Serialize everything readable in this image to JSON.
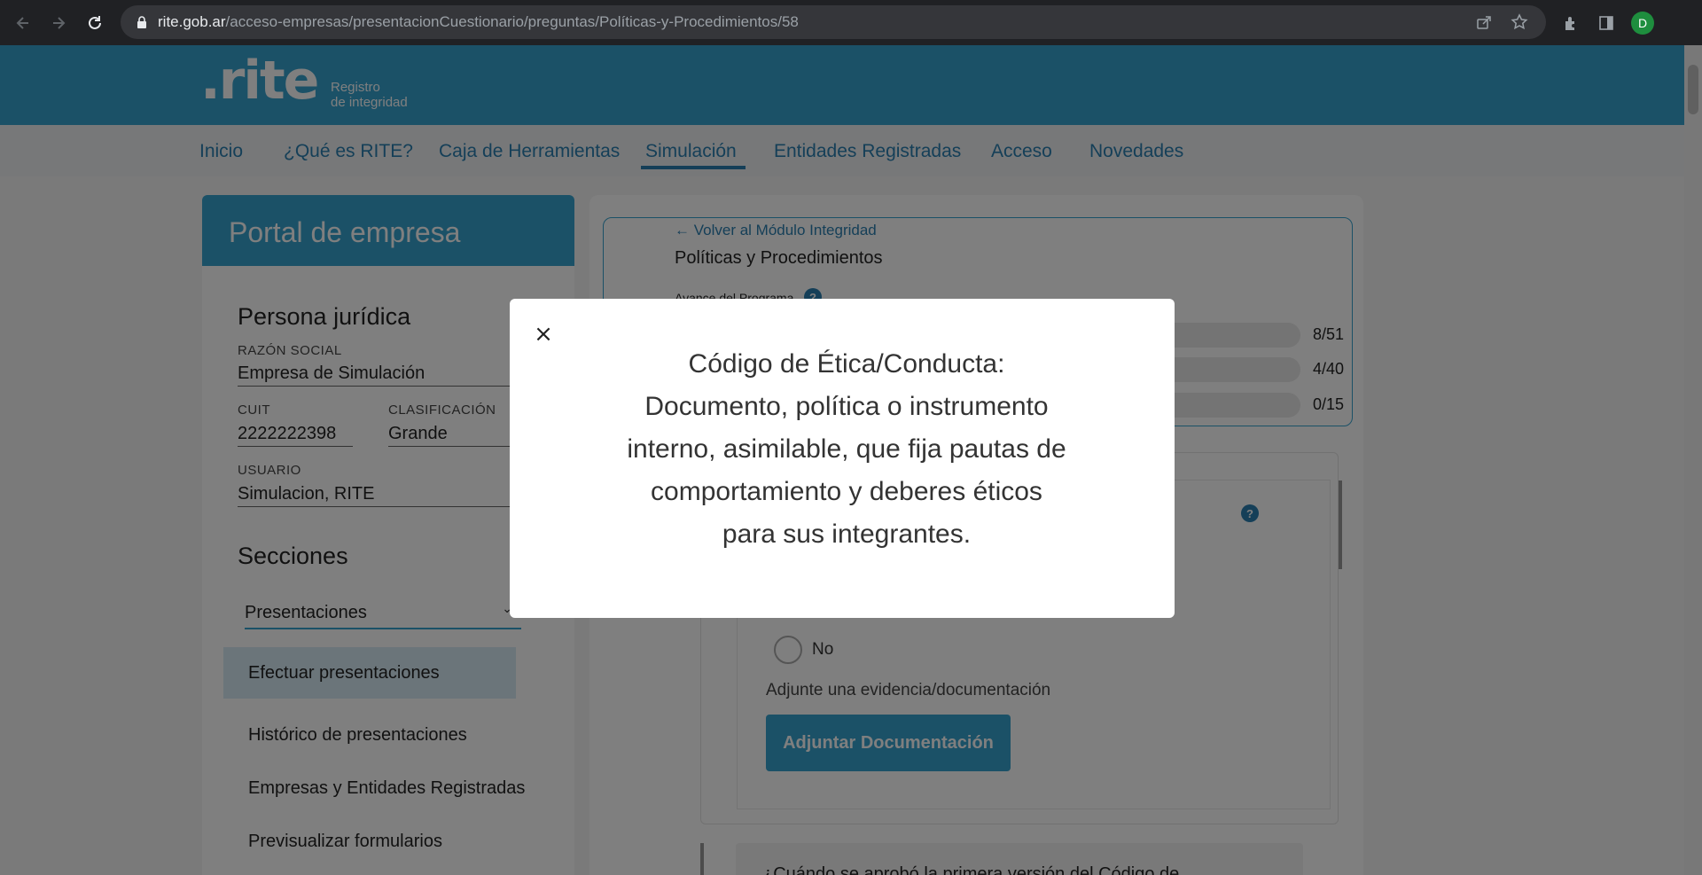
{
  "browser": {
    "url_host": "rite.gob.ar",
    "url_path": "/acceso-empresas/presentacionCuestionario/preguntas/Políticas-y-Procedimientos/58",
    "profile_initial": "D",
    "icons": [
      "back-icon",
      "forward-icon",
      "reload-icon",
      "lock-icon",
      "share-icon",
      "star-icon",
      "extensions-icon",
      "side-panel-icon"
    ]
  },
  "header": {
    "logo": ".rite",
    "logo_sub_1": "Registro",
    "logo_sub_2": "de integridad",
    "brand_color": "#37a3cf"
  },
  "nav": {
    "items": [
      {
        "label": "Inicio"
      },
      {
        "label": "¿Qué es RITE?"
      },
      {
        "label": "Caja de Herramientas"
      },
      {
        "label": "Simulación"
      },
      {
        "label": "Entidades Registradas"
      },
      {
        "label": "Acceso"
      },
      {
        "label": "Novedades"
      }
    ],
    "active": "Simulación"
  },
  "sidebar": {
    "title": "Portal de empresa",
    "persona_heading": "Persona jurídica",
    "razon_label": "RAZÓN SOCIAL",
    "razon_value": "Empresa de Simulación",
    "cuit_label": "CUIT",
    "cuit_value": "2222222398",
    "clasif_label": "CLASIFICACIÓN",
    "clasif_value": "Grande",
    "usuario_label": "USUARIO",
    "usuario_value": "Simulacion, RITE",
    "secciones_heading": "Secciones",
    "select_value": "Presentaciones",
    "items": [
      {
        "label": "Efectuar presentaciones"
      },
      {
        "label": "Histórico de presentaciones"
      },
      {
        "label": "Empresas y Entidades Registradas"
      },
      {
        "label": "Previsualizar formularios"
      }
    ]
  },
  "module": {
    "back_link": "Volver al Módulo Integridad",
    "title": "Políticas y Procedimientos",
    "avance_label": "Avance del Programa",
    "progress": [
      {
        "label": "8/51",
        "fraction": 0.157
      },
      {
        "label": "4/40",
        "fraction": 0.1
      },
      {
        "label": "0/15",
        "fraction": 0
      }
    ]
  },
  "question": {
    "option_no": "No",
    "attach_label": "Adjunte una evidencia/documentación",
    "attach_button": "Adjuntar Documentación",
    "next_question": "¿Cuándo se aprobó la primera versión del Código de"
  },
  "modal": {
    "close": "×",
    "lines": [
      "Código de Ética/Conducta:",
      "Documento, política o instrumento",
      "interno, asimilable, que fija pautas de",
      "comportamiento y deberes éticos",
      "para sus integrantes."
    ]
  }
}
